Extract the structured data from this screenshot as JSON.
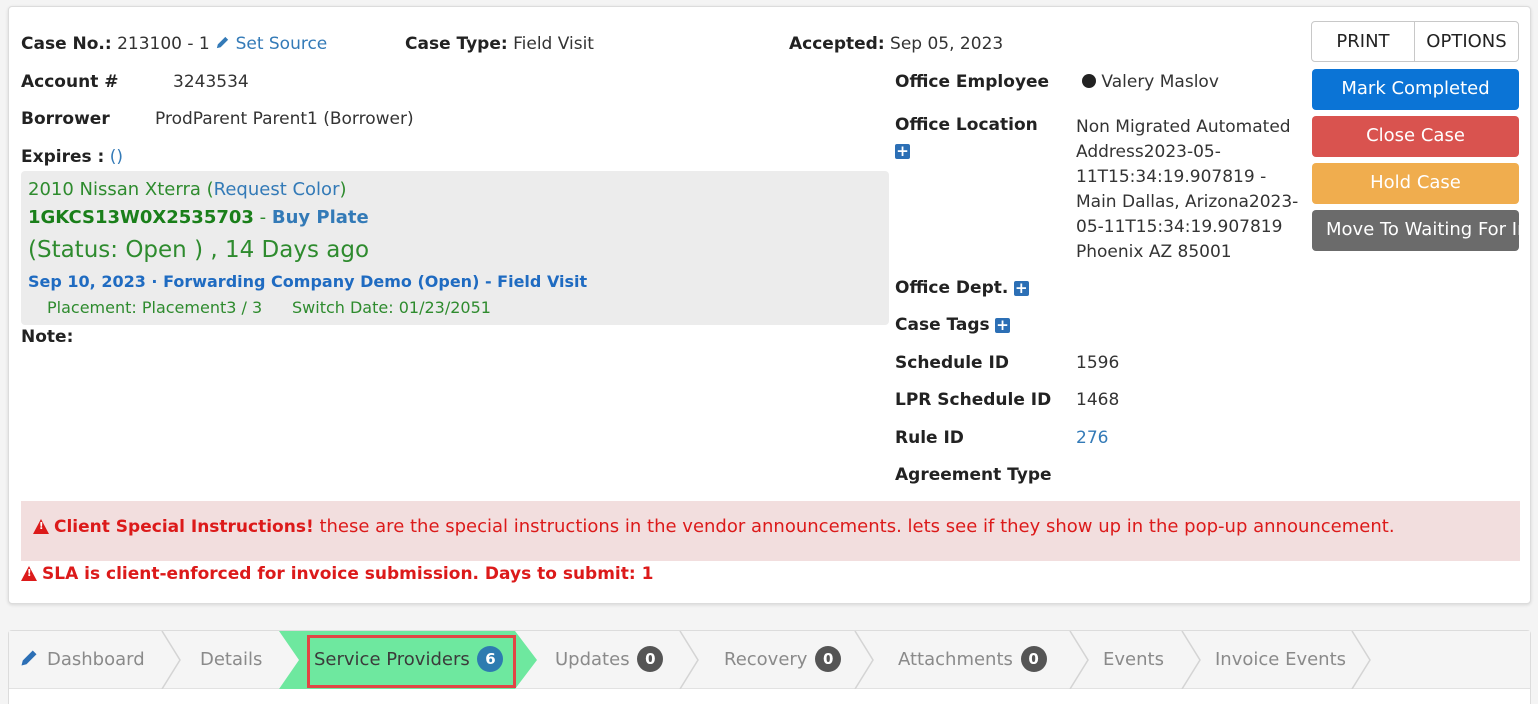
{
  "header": {
    "case_no_label": "Case No.:",
    "case_no_value": "213100 - 1",
    "set_source": "Set Source",
    "case_type_label": "Case Type:",
    "case_type_value": "Field Visit",
    "accepted_label": "Accepted:",
    "accepted_value": "Sep 05, 2023"
  },
  "left": {
    "account_label": "Account #",
    "account_value": "3243534",
    "borrower_label": "Borrower",
    "borrower_value": "ProdParent Parent1 (Borrower)",
    "expires_label": "Expires :",
    "expires_value": "()",
    "note_label": "Note:"
  },
  "vehicle": {
    "name": "2010 Nissan Xterra (",
    "request_color": "Request Color",
    "name_close": ")",
    "vin": "1GKCS13W0X2535703",
    "dash": " - ",
    "buy_plate": "Buy Plate",
    "status": "(Status: Open ) , 14 Days ago",
    "forwarding": "Sep 10, 2023 · Forwarding Company Demo (Open) - Field Visit",
    "placement": "Placement: Placement3 / 3",
    "switch_date": "Switch Date: 01/23/2051"
  },
  "right": {
    "office_employee_label": "Office Employee",
    "office_employee_value": "Valery Maslov",
    "office_location_label": "Office Location",
    "office_location_lines": [
      "Non Migrated Automated",
      "Address2023-05-",
      "11T15:34:19.907819 -",
      "Main Dallas, Arizona2023-",
      "05-11T15:34:19.907819",
      "Phoenix AZ 85001"
    ],
    "office_dept_label": "Office Dept.",
    "case_tags_label": "Case Tags",
    "schedule_id_label": "Schedule ID",
    "schedule_id_value": "1596",
    "lpr_schedule_id_label": "LPR Schedule ID",
    "lpr_schedule_id_value": "1468",
    "rule_id_label": "Rule ID",
    "rule_id_value": "276",
    "agreement_type_label": "Agreement Type"
  },
  "buttons": {
    "print": "PRINT",
    "options": "OPTIONS",
    "mark_completed": "Mark Completed",
    "close_case": "Close Case",
    "hold_case": "Hold Case",
    "move_waiting": "Move To Waiting For Info"
  },
  "alerts": {
    "special_title": "Client Special Instructions!",
    "special_text": " these are the special instructions in the vendor announcements.  lets see if they show up in the pop-up announcement.",
    "sla_text": "SLA is client-enforced for invoice submission. Days to submit: 1"
  },
  "tabs": [
    {
      "label": "Dashboard"
    },
    {
      "label": "Details"
    },
    {
      "label": "Service Providers",
      "count": "6"
    },
    {
      "label": "Updates",
      "count": "0"
    },
    {
      "label": "Recovery",
      "count": "0"
    },
    {
      "label": "Attachments",
      "count": "0"
    },
    {
      "label": "Events"
    },
    {
      "label": "Invoice Events"
    }
  ],
  "colors": {
    "primary": "#0b74d6",
    "danger": "#d9534f",
    "warning": "#f0ad4e",
    "active_tab": "#6ee89f",
    "highlight": "#e24545"
  }
}
